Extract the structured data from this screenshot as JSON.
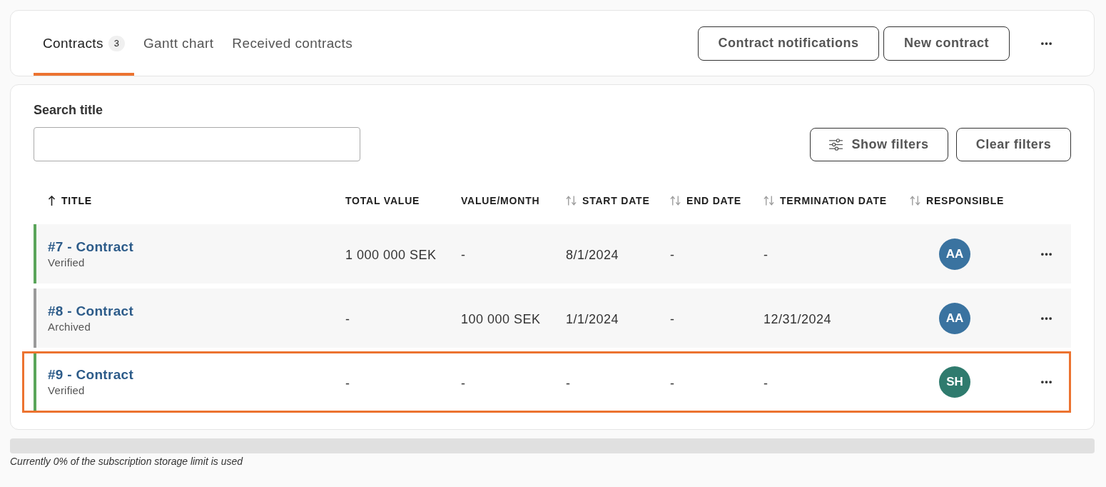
{
  "tabs": [
    {
      "label": "Contracts",
      "count": "3",
      "selected": true
    },
    {
      "label": "Gantt chart",
      "selected": false
    },
    {
      "label": "Received contracts",
      "selected": false
    }
  ],
  "header_buttons": [
    "Contract notifications",
    "New contract"
  ],
  "search": {
    "label": "Search title"
  },
  "filter_buttons": [
    {
      "label": "Show filters",
      "kind": "icon"
    },
    {
      "label": "Clear filters",
      "kind": "text"
    }
  ],
  "table": {
    "columns": [
      {
        "label": "TITLE",
        "sortable": true,
        "sorted": true
      },
      {
        "label": "TOTAL VALUE",
        "sortable": false,
        "sorted": false
      },
      {
        "label": "VALUE/MONTH",
        "sortable": false,
        "sorted": false
      },
      {
        "label": "START DATE",
        "sortable": true,
        "sorted": false
      },
      {
        "label": "END DATE",
        "sortable": true,
        "sorted": false
      },
      {
        "label": "TERMINATION DATE",
        "sortable": true,
        "sorted": false
      },
      {
        "label": "RESPONSIBLE",
        "sortable": true,
        "sorted": false
      }
    ],
    "rows": [
      {
        "color": "#5aa55a",
        "selected": false,
        "cells": [
          {
            "kind": "title",
            "text": "#7 - Contract",
            "status": "Verified"
          },
          {
            "kind": "text",
            "text": "1 000 000 SEK"
          },
          {
            "kind": "text",
            "text": "-"
          },
          {
            "kind": "text",
            "text": "8/1/2024"
          },
          {
            "kind": "text",
            "text": "-"
          },
          {
            "kind": "text",
            "text": "-"
          },
          {
            "kind": "avatar",
            "text": "AA",
            "color": "#3a73a0"
          }
        ]
      },
      {
        "color": "#9a9a9a",
        "selected": false,
        "cells": [
          {
            "kind": "title",
            "text": "#8 - Contract",
            "status": "Archived"
          },
          {
            "kind": "text",
            "text": "-"
          },
          {
            "kind": "text",
            "text": "100 000 SEK"
          },
          {
            "kind": "text",
            "text": "1/1/2024"
          },
          {
            "kind": "text",
            "text": "-"
          },
          {
            "kind": "text",
            "text": "12/31/2024"
          },
          {
            "kind": "avatar",
            "text": "AA",
            "color": "#3a73a0"
          }
        ]
      },
      {
        "color": "#5aa55a",
        "selected": true,
        "cells": [
          {
            "kind": "title",
            "text": "#9 - Contract",
            "status": "Verified"
          },
          {
            "kind": "text",
            "text": "-"
          },
          {
            "kind": "text",
            "text": "-"
          },
          {
            "kind": "text",
            "text": "-"
          },
          {
            "kind": "text",
            "text": "-"
          },
          {
            "kind": "text",
            "text": "-"
          },
          {
            "kind": "avatar",
            "text": "SH",
            "color": "#2f7b6e"
          }
        ]
      }
    ]
  },
  "storage": {
    "level": 0,
    "caption": "Currently 0% of the subscription storage limit is used"
  }
}
